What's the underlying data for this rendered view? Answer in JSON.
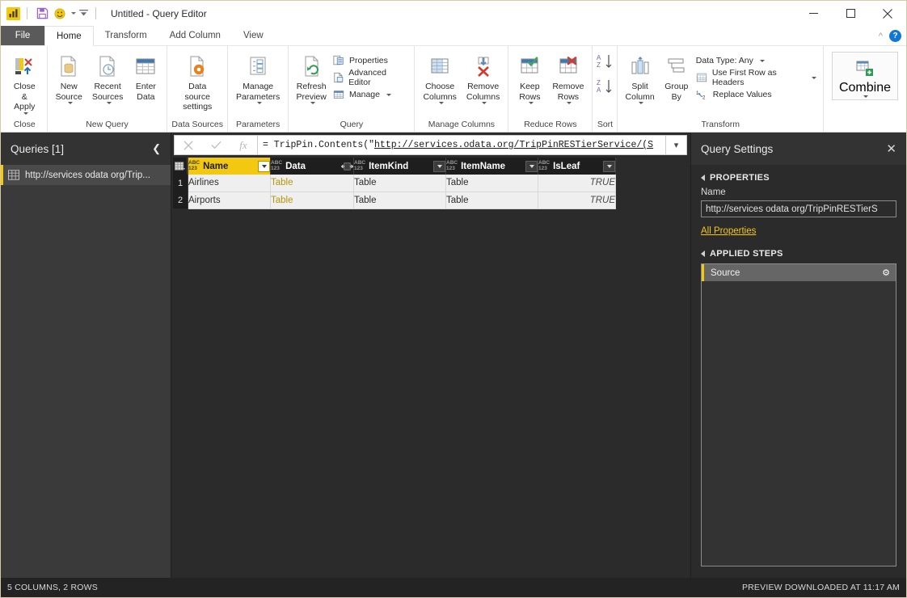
{
  "window": {
    "title": "Untitled - Query Editor",
    "app_icon": "powerbi-icon",
    "quick_access": [
      {
        "name": "save-icon",
        "label": "Save"
      },
      {
        "name": "emoji-feedback-icon",
        "label": "Send a Smile"
      },
      {
        "name": "customize-qat-icon",
        "label": "Customize Quick Access Toolbar"
      }
    ],
    "controls": {
      "minimize": "minimize-icon",
      "maximize": "maximize-icon",
      "close": "close-icon"
    }
  },
  "tabs": {
    "file_label": "File",
    "items": [
      {
        "label": "Home",
        "active": true
      },
      {
        "label": "Transform",
        "active": false
      },
      {
        "label": "Add Column",
        "active": false
      },
      {
        "label": "View",
        "active": false
      }
    ],
    "collapse_ribbon": "chevron-up-icon",
    "help": "?"
  },
  "ribbon": {
    "groups": [
      {
        "name": "close",
        "label": "Close",
        "buttons": [
          {
            "label": "Close &\nApply",
            "icon": "close-apply-icon",
            "dropdown": true
          }
        ]
      },
      {
        "name": "new-query",
        "label": "New Query",
        "buttons": [
          {
            "label": "New\nSource",
            "icon": "new-source-icon",
            "dropdown": true
          },
          {
            "label": "Recent\nSources",
            "icon": "recent-sources-icon",
            "dropdown": true
          },
          {
            "label": "Enter\nData",
            "icon": "enter-data-icon",
            "dropdown": false
          }
        ]
      },
      {
        "name": "data-sources",
        "label": "Data Sources",
        "buttons": [
          {
            "label": "Data source\nsettings",
            "icon": "data-source-settings-icon",
            "dropdown": false
          }
        ]
      },
      {
        "name": "parameters",
        "label": "Parameters",
        "buttons": [
          {
            "label": "Manage\nParameters",
            "icon": "manage-parameters-icon",
            "dropdown": true
          }
        ]
      },
      {
        "name": "query",
        "label": "Query",
        "buttons": [
          {
            "label": "Refresh\nPreview",
            "icon": "refresh-preview-icon",
            "dropdown": true
          }
        ],
        "small_buttons": [
          {
            "label": "Properties",
            "icon": "properties-icon",
            "dropdown": false
          },
          {
            "label": "Advanced Editor",
            "icon": "advanced-editor-icon",
            "dropdown": false
          },
          {
            "label": "Manage",
            "icon": "manage-query-icon",
            "dropdown": true
          }
        ]
      },
      {
        "name": "manage-columns",
        "label": "Manage Columns",
        "buttons": [
          {
            "label": "Choose\nColumns",
            "icon": "choose-columns-icon",
            "dropdown": true
          },
          {
            "label": "Remove\nColumns",
            "icon": "remove-columns-icon",
            "dropdown": true
          }
        ]
      },
      {
        "name": "reduce-rows",
        "label": "Reduce Rows",
        "buttons": [
          {
            "label": "Keep\nRows",
            "icon": "keep-rows-icon",
            "dropdown": true
          },
          {
            "label": "Remove\nRows",
            "icon": "remove-rows-icon",
            "dropdown": true
          }
        ]
      },
      {
        "name": "sort",
        "label": "Sort",
        "small_buttons": [
          {
            "label": "",
            "icon": "sort-ascending-icon",
            "dropdown": false
          },
          {
            "label": "",
            "icon": "sort-descending-icon",
            "dropdown": false
          }
        ]
      },
      {
        "name": "transform",
        "label": "Transform",
        "buttons": [
          {
            "label": "Split\nColumn",
            "icon": "split-column-icon",
            "dropdown": true
          },
          {
            "label": "Group\nBy",
            "icon": "group-by-icon",
            "dropdown": false
          }
        ],
        "small_buttons": [
          {
            "label": "Data Type: Any",
            "icon": "data-type-icon",
            "dropdown": true
          },
          {
            "label": "Use First Row as Headers",
            "icon": "first-row-headers-icon",
            "dropdown": true
          },
          {
            "label": "Replace Values",
            "icon": "replace-values-icon",
            "dropdown": false
          }
        ]
      },
      {
        "name": "combine",
        "label": "",
        "buttons": [
          {
            "label": "Combine",
            "icon": "combine-icon",
            "dropdown": true
          }
        ]
      }
    ]
  },
  "queries_pane": {
    "title": "Queries [1]",
    "collapse_icon": "chevron-left-icon",
    "items": [
      {
        "label": "http://services odata org/Trip...",
        "icon": "table-icon",
        "selected": true
      }
    ]
  },
  "formula_bar": {
    "cancel_icon": "cancel-icon",
    "confirm_icon": "checkmark-icon",
    "fx_icon": "fx-icon",
    "prefix": "= TripPin.Contents(\"",
    "url": "http://services.odata.org/TripPinRESTierService/(S",
    "full_value": "= TripPin.Contents(\"http://services.odata.org/TripPinRESTierService/(S",
    "expand_icon": "chevron-down-icon"
  },
  "grid": {
    "select_all_icon": "select-all-table-icon",
    "columns": [
      {
        "name": "Name",
        "type_badge": "ABC\n123",
        "control": "dropdown",
        "selected": true
      },
      {
        "name": "Data",
        "type_badge": "ABC\n123",
        "control": "expand",
        "selected": false
      },
      {
        "name": "ItemKind",
        "type_badge": "ABC\n123",
        "control": "dropdown",
        "selected": false
      },
      {
        "name": "ItemName",
        "type_badge": "ABC\n123",
        "control": "dropdown",
        "selected": false
      },
      {
        "name": "IsLeaf",
        "type_badge": "ABC\n123",
        "control": "dropdown",
        "selected": false
      }
    ],
    "rows": [
      {
        "num": "1",
        "cells": [
          "Airlines",
          "Table",
          "Table",
          "Table",
          "TRUE"
        ]
      },
      {
        "num": "2",
        "cells": [
          "Airports",
          "Table",
          "Table",
          "Table",
          "TRUE"
        ]
      }
    ],
    "link_column_index": 1,
    "italic_column_index": 4
  },
  "query_settings": {
    "title": "Query Settings",
    "close_icon": "close-icon",
    "properties": {
      "section_label": "PROPERTIES",
      "name_label": "Name",
      "name_value": "http://services odata org/TripPinRESTierS",
      "all_properties_link": "All Properties"
    },
    "applied_steps": {
      "section_label": "APPLIED STEPS",
      "steps": [
        {
          "label": "Source",
          "gear_icon": "gear-icon",
          "selected": true
        }
      ]
    }
  },
  "status_bar": {
    "left": "5 COLUMNS, 2 ROWS",
    "right": "PREVIEW DOWNLOADED AT 11:17 AM"
  },
  "colors": {
    "accent_yellow": "#f2c811",
    "panel_dark": "#2b2b2b",
    "header_dark": "#333333",
    "grid_header": "#1e1e1e",
    "cell_bg": "#efefef",
    "file_tab": "#5a5a5a",
    "help_blue": "#1176d4"
  }
}
